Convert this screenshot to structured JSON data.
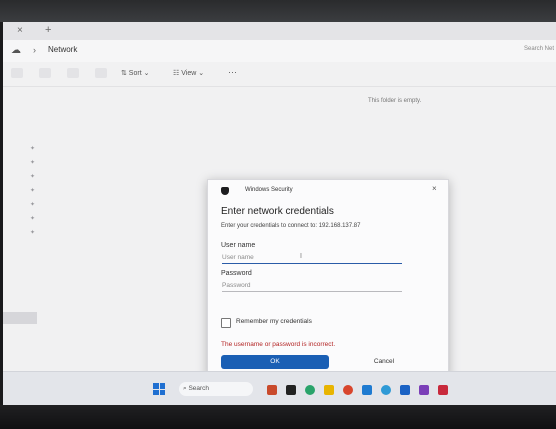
{
  "explorer": {
    "tab_close": "×",
    "tab_new": "+",
    "breadcrumb": "Network",
    "search_placeholder": "Search Net",
    "sort_label": "⇅ Sort ⌄",
    "view_label": "☷ View ⌄",
    "more_label": "···",
    "empty_message": "This folder is empty."
  },
  "dialog": {
    "title": "Windows Security",
    "close_glyph": "×",
    "heading": "Enter network credentials",
    "prompt": "Enter your credentials to connect to: 192.168.137.87",
    "username_label": "User name",
    "username_placeholder": "User name",
    "password_label": "Password",
    "password_placeholder": "Password",
    "remember_label": "Remember my credentials",
    "remember_checked": false,
    "error_text": "The username or password is incorrect.",
    "ok_label": "OK",
    "cancel_label": "Cancel",
    "accent_color": "#1a5fb4",
    "error_color": "#b32424"
  },
  "taskbar": {
    "search_label": "Search",
    "apps": [
      "cloud-app-icon",
      "task-view-icon",
      "edge-icon",
      "file-explorer-icon",
      "chrome-icon",
      "vscode-icon",
      "chrome-icon",
      "mail-icon",
      "visual-studio-icon",
      "store-icon"
    ]
  }
}
